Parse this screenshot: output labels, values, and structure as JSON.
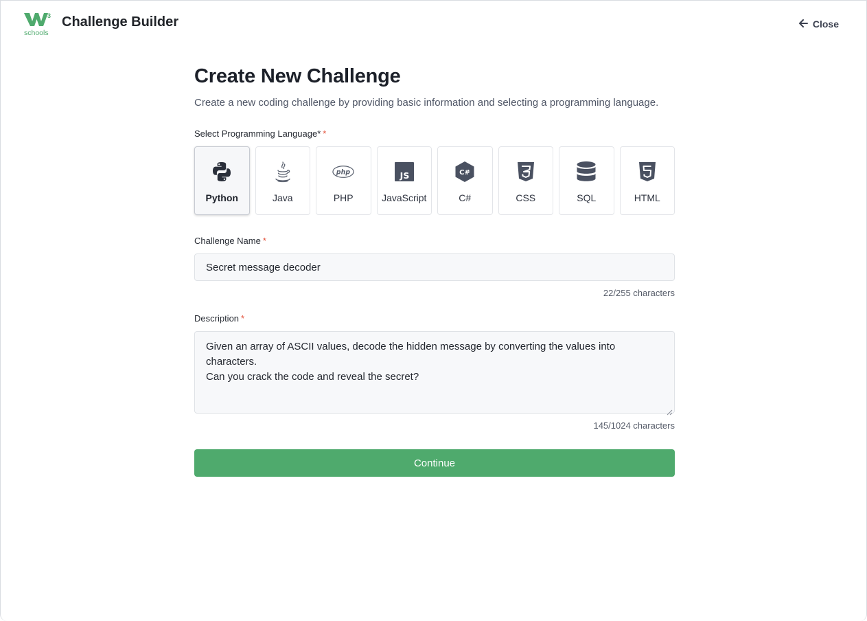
{
  "header": {
    "logo_text": "schools",
    "logo_superscript": "3",
    "title": "Challenge Builder",
    "close_label": "Close",
    "close_icon": "arrow-left-icon"
  },
  "page": {
    "title": "Create New Challenge",
    "subtitle": "Create a new coding challenge by providing basic information and selecting a programming language."
  },
  "language_section": {
    "label": "Select Programming Language*",
    "required_mark": "*",
    "selected": "Python",
    "languages": [
      {
        "name": "Python",
        "icon": "python-icon"
      },
      {
        "name": "Java",
        "icon": "java-icon"
      },
      {
        "name": "PHP",
        "icon": "php-icon"
      },
      {
        "name": "JavaScript",
        "icon": "javascript-icon"
      },
      {
        "name": "C#",
        "icon": "csharp-icon"
      },
      {
        "name": "CSS",
        "icon": "css-icon"
      },
      {
        "name": "SQL",
        "icon": "database-icon"
      },
      {
        "name": "HTML",
        "icon": "html-icon"
      }
    ]
  },
  "challenge_name": {
    "label": "Challenge Name",
    "required_mark": "*",
    "value": "Secret message decoder",
    "counter": "22/255 characters"
  },
  "description": {
    "label": "Description",
    "required_mark": "*",
    "value_line1": "Given an array of ASCII values, decode the hidden message by converting the values into characters.",
    "value_line2": "Can you crack the code and reveal the secret?",
    "counter": "145/1024 characters"
  },
  "actions": {
    "continue_label": "Continue"
  },
  "colors": {
    "brand_green": "#4faa6d",
    "required_red": "#e4543e",
    "icon_slate": "#4a5161"
  }
}
